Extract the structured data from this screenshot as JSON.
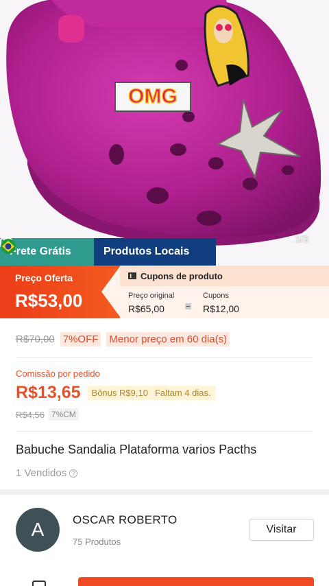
{
  "product_image": {
    "counter": "1/3",
    "charm_text": "OMG"
  },
  "badges": {
    "free_shipping": "Frete Grátis",
    "local_products": "Produtos Locais"
  },
  "offer": {
    "label": "Preço Oferta",
    "price": "R$53,00"
  },
  "coupons": {
    "title": "Cupons de produto",
    "original_label": "Preço original",
    "original_value": "R$65,00",
    "coupon_label": "Cupons",
    "coupon_value": "R$12,00"
  },
  "discount": {
    "old_price": "R$70,00",
    "percent": "7%OFF",
    "lowest": "Menor preço em 60 dia(s)"
  },
  "commission": {
    "label": "Comissão por pedido",
    "price": "R$13,65",
    "bonus": "Bônus R$9,10",
    "remaining": "Faltam 4 dias.",
    "old": "R$4,56",
    "rate": "7%CM"
  },
  "product": {
    "title": "Babuche Sandalia Plataforma varios Pacths",
    "sold": "1 Vendidos"
  },
  "shop": {
    "initial": "A",
    "name": "OSCAR ROBERTO",
    "count": "75 Produtos",
    "visit_label": "Visitar"
  },
  "colors": {
    "accent": "#e8502a",
    "shoe": "#b0208f",
    "free_badge": "#2f9b8f",
    "local_badge": "#113e7e"
  }
}
